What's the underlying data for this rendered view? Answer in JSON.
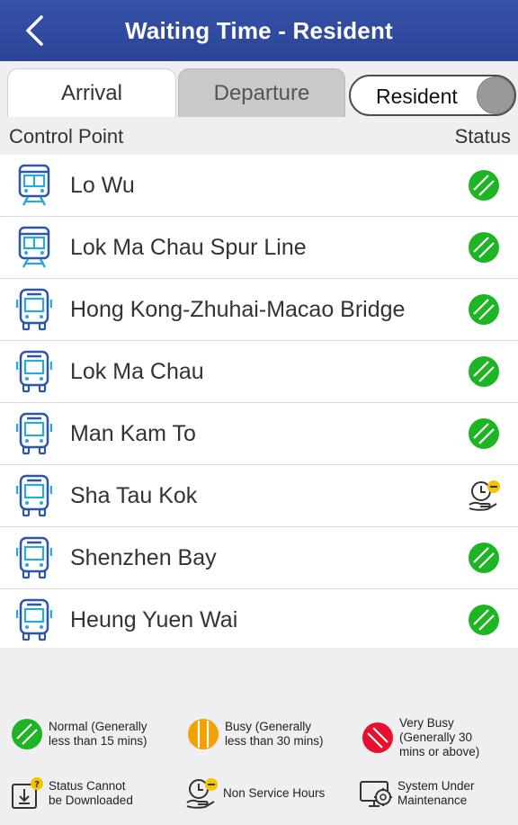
{
  "header": {
    "title": "Waiting Time - Resident"
  },
  "tabs": [
    {
      "label": "Arrival",
      "active": true
    },
    {
      "label": "Departure",
      "active": false
    }
  ],
  "toggle": {
    "label": "Resident"
  },
  "columns": {
    "control_point": "Control Point",
    "status": "Status"
  },
  "control_points": [
    {
      "name": "Lo Wu",
      "icon": "train-icon",
      "status": "normal"
    },
    {
      "name": "Lok Ma Chau Spur Line",
      "icon": "train-icon",
      "status": "normal"
    },
    {
      "name": "Hong Kong-Zhuhai-Macao Bridge",
      "icon": "bus-icon",
      "status": "normal"
    },
    {
      "name": "Lok Ma Chau",
      "icon": "bus-icon",
      "status": "normal"
    },
    {
      "name": "Man Kam To",
      "icon": "bus-icon",
      "status": "normal"
    },
    {
      "name": "Sha Tau Kok",
      "icon": "bus-icon",
      "status": "non-service"
    },
    {
      "name": "Shenzhen Bay",
      "icon": "bus-icon",
      "status": "normal"
    },
    {
      "name": "Heung Yuen Wai",
      "icon": "bus-icon",
      "status": "normal"
    }
  ],
  "legend": {
    "normal": "Normal (Generally\nless than 15 mins)",
    "busy": "Busy (Generally\nless than 30 mins)",
    "very_busy": "Very Busy\n(Generally 30\nmins or above)",
    "cannot_download": "Status Cannot\nbe Downloaded",
    "non_service": "Non Service Hours",
    "maintenance": "System Under\nMaintenance"
  },
  "colors": {
    "header": "#2f4a9e",
    "normal": "#1db523",
    "busy": "#f2a100",
    "very_busy": "#e8112d",
    "icon_blue": "#2f55a8",
    "icon_cyan": "#29a9d6"
  }
}
